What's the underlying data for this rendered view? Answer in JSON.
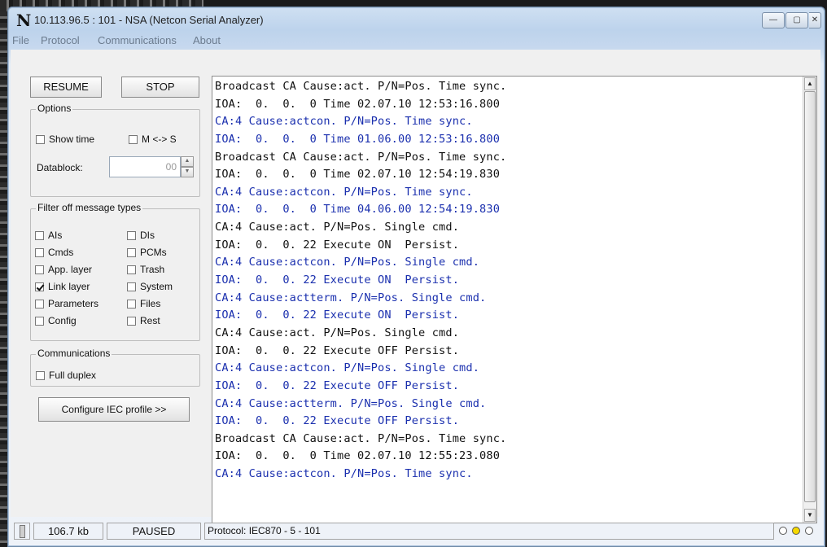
{
  "window": {
    "app_icon_letter": "N",
    "title": "10.113.96.5 : 101 - NSA (Netcon Serial Analyzer)",
    "controls": {
      "minimize": "—",
      "maximize": "▢",
      "close": "✕"
    }
  },
  "menu": [
    "File",
    "Protocol",
    "Communications",
    "About"
  ],
  "controls": {
    "resume_label": "RESUME",
    "stop_label": "STOP",
    "options_label": "Options",
    "show_time_label": "Show time",
    "show_time_checked": false,
    "m_s_label": "M <-> S",
    "m_s_checked": false,
    "datablock_label": "Datablock:",
    "datablock_value": "00",
    "filter_label": "Filter off message types",
    "filters": [
      {
        "label": "AIs",
        "checked": false
      },
      {
        "label": "DIs",
        "checked": false
      },
      {
        "label": "Cmds",
        "checked": false
      },
      {
        "label": "PCMs",
        "checked": false
      },
      {
        "label": "App. layer",
        "checked": false
      },
      {
        "label": "Trash",
        "checked": false
      },
      {
        "label": "Link layer",
        "checked": true
      },
      {
        "label": "System",
        "checked": false
      },
      {
        "label": "Parameters",
        "checked": false
      },
      {
        "label": "Files",
        "checked": false
      },
      {
        "label": "Config",
        "checked": false
      },
      {
        "label": "Rest",
        "checked": false
      }
    ],
    "communications_label": "Communications",
    "full_duplex_label": "Full duplex",
    "full_duplex_checked": false,
    "configure_label": "Configure IEC profile >>"
  },
  "log": [
    {
      "text": "Broadcast CA Cause:act. P/N=Pos. Time sync.",
      "kind": "req"
    },
    {
      "text": "IOA:  0.  0.  0 Time 02.07.10 12:53:16.800",
      "kind": "req"
    },
    {
      "text": "CA:4 Cause:actcon. P/N=Pos. Time sync.",
      "kind": "res"
    },
    {
      "text": "IOA:  0.  0.  0 Time 01.06.00 12:53:16.800",
      "kind": "res"
    },
    {
      "text": "Broadcast CA Cause:act. P/N=Pos. Time sync.",
      "kind": "req"
    },
    {
      "text": "IOA:  0.  0.  0 Time 02.07.10 12:54:19.830",
      "kind": "req"
    },
    {
      "text": "CA:4 Cause:actcon. P/N=Pos. Time sync.",
      "kind": "res"
    },
    {
      "text": "IOA:  0.  0.  0 Time 04.06.00 12:54:19.830",
      "kind": "res"
    },
    {
      "text": "CA:4 Cause:act. P/N=Pos. Single cmd.",
      "kind": "req"
    },
    {
      "text": "IOA:  0.  0. 22 Execute ON  Persist.",
      "kind": "req"
    },
    {
      "text": "CA:4 Cause:actcon. P/N=Pos. Single cmd.",
      "kind": "res"
    },
    {
      "text": "IOA:  0.  0. 22 Execute ON  Persist.",
      "kind": "res"
    },
    {
      "text": "CA:4 Cause:actterm. P/N=Pos. Single cmd.",
      "kind": "res"
    },
    {
      "text": "IOA:  0.  0. 22 Execute ON  Persist.",
      "kind": "res"
    },
    {
      "text": "CA:4 Cause:act. P/N=Pos. Single cmd.",
      "kind": "req"
    },
    {
      "text": "IOA:  0.  0. 22 Execute OFF Persist.",
      "kind": "req"
    },
    {
      "text": "CA:4 Cause:actcon. P/N=Pos. Single cmd.",
      "kind": "res"
    },
    {
      "text": "IOA:  0.  0. 22 Execute OFF Persist.",
      "kind": "res"
    },
    {
      "text": "CA:4 Cause:actterm. P/N=Pos. Single cmd.",
      "kind": "res"
    },
    {
      "text": "IOA:  0.  0. 22 Execute OFF Persist.",
      "kind": "res"
    },
    {
      "text": "Broadcast CA Cause:act. P/N=Pos. Time sync.",
      "kind": "req"
    },
    {
      "text": "IOA:  0.  0.  0 Time 02.07.10 12:55:23.080",
      "kind": "req"
    },
    {
      "text": "CA:4 Cause:actcon. P/N=Pos. Time sync.",
      "kind": "res"
    }
  ],
  "colors": {
    "request_text": "#111111",
    "response_text": "#1a2fae",
    "led_yellow": "#f5d800"
  },
  "status": {
    "size": "106.7 kb",
    "state": "PAUSED",
    "protocol": "Protocol: IEC870 - 5 - 101",
    "leds": [
      "off",
      "yellow",
      "off"
    ]
  }
}
